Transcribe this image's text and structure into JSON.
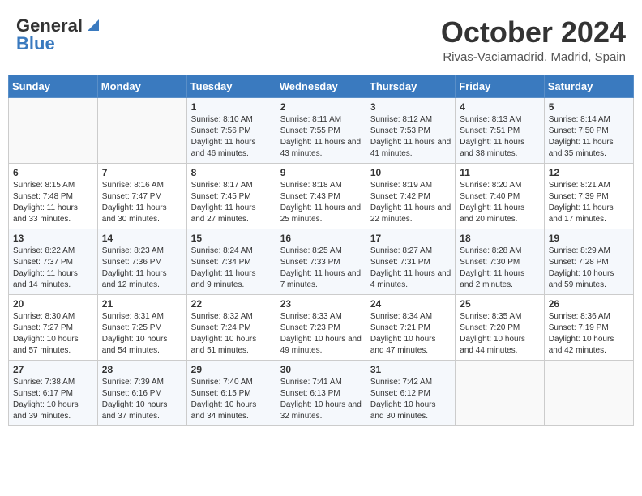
{
  "header": {
    "logo_general": "General",
    "logo_blue": "Blue",
    "month": "October 2024",
    "location": "Rivas-Vaciamadrid, Madrid, Spain"
  },
  "weekdays": [
    "Sunday",
    "Monday",
    "Tuesday",
    "Wednesday",
    "Thursday",
    "Friday",
    "Saturday"
  ],
  "weeks": [
    [
      {
        "day": "",
        "info": ""
      },
      {
        "day": "",
        "info": ""
      },
      {
        "day": "1",
        "info": "Sunrise: 8:10 AM\nSunset: 7:56 PM\nDaylight: 11 hours and 46 minutes."
      },
      {
        "day": "2",
        "info": "Sunrise: 8:11 AM\nSunset: 7:55 PM\nDaylight: 11 hours and 43 minutes."
      },
      {
        "day": "3",
        "info": "Sunrise: 8:12 AM\nSunset: 7:53 PM\nDaylight: 11 hours and 41 minutes."
      },
      {
        "day": "4",
        "info": "Sunrise: 8:13 AM\nSunset: 7:51 PM\nDaylight: 11 hours and 38 minutes."
      },
      {
        "day": "5",
        "info": "Sunrise: 8:14 AM\nSunset: 7:50 PM\nDaylight: 11 hours and 35 minutes."
      }
    ],
    [
      {
        "day": "6",
        "info": "Sunrise: 8:15 AM\nSunset: 7:48 PM\nDaylight: 11 hours and 33 minutes."
      },
      {
        "day": "7",
        "info": "Sunrise: 8:16 AM\nSunset: 7:47 PM\nDaylight: 11 hours and 30 minutes."
      },
      {
        "day": "8",
        "info": "Sunrise: 8:17 AM\nSunset: 7:45 PM\nDaylight: 11 hours and 27 minutes."
      },
      {
        "day": "9",
        "info": "Sunrise: 8:18 AM\nSunset: 7:43 PM\nDaylight: 11 hours and 25 minutes."
      },
      {
        "day": "10",
        "info": "Sunrise: 8:19 AM\nSunset: 7:42 PM\nDaylight: 11 hours and 22 minutes."
      },
      {
        "day": "11",
        "info": "Sunrise: 8:20 AM\nSunset: 7:40 PM\nDaylight: 11 hours and 20 minutes."
      },
      {
        "day": "12",
        "info": "Sunrise: 8:21 AM\nSunset: 7:39 PM\nDaylight: 11 hours and 17 minutes."
      }
    ],
    [
      {
        "day": "13",
        "info": "Sunrise: 8:22 AM\nSunset: 7:37 PM\nDaylight: 11 hours and 14 minutes."
      },
      {
        "day": "14",
        "info": "Sunrise: 8:23 AM\nSunset: 7:36 PM\nDaylight: 11 hours and 12 minutes."
      },
      {
        "day": "15",
        "info": "Sunrise: 8:24 AM\nSunset: 7:34 PM\nDaylight: 11 hours and 9 minutes."
      },
      {
        "day": "16",
        "info": "Sunrise: 8:25 AM\nSunset: 7:33 PM\nDaylight: 11 hours and 7 minutes."
      },
      {
        "day": "17",
        "info": "Sunrise: 8:27 AM\nSunset: 7:31 PM\nDaylight: 11 hours and 4 minutes."
      },
      {
        "day": "18",
        "info": "Sunrise: 8:28 AM\nSunset: 7:30 PM\nDaylight: 11 hours and 2 minutes."
      },
      {
        "day": "19",
        "info": "Sunrise: 8:29 AM\nSunset: 7:28 PM\nDaylight: 10 hours and 59 minutes."
      }
    ],
    [
      {
        "day": "20",
        "info": "Sunrise: 8:30 AM\nSunset: 7:27 PM\nDaylight: 10 hours and 57 minutes."
      },
      {
        "day": "21",
        "info": "Sunrise: 8:31 AM\nSunset: 7:25 PM\nDaylight: 10 hours and 54 minutes."
      },
      {
        "day": "22",
        "info": "Sunrise: 8:32 AM\nSunset: 7:24 PM\nDaylight: 10 hours and 51 minutes."
      },
      {
        "day": "23",
        "info": "Sunrise: 8:33 AM\nSunset: 7:23 PM\nDaylight: 10 hours and 49 minutes."
      },
      {
        "day": "24",
        "info": "Sunrise: 8:34 AM\nSunset: 7:21 PM\nDaylight: 10 hours and 47 minutes."
      },
      {
        "day": "25",
        "info": "Sunrise: 8:35 AM\nSunset: 7:20 PM\nDaylight: 10 hours and 44 minutes."
      },
      {
        "day": "26",
        "info": "Sunrise: 8:36 AM\nSunset: 7:19 PM\nDaylight: 10 hours and 42 minutes."
      }
    ],
    [
      {
        "day": "27",
        "info": "Sunrise: 7:38 AM\nSunset: 6:17 PM\nDaylight: 10 hours and 39 minutes."
      },
      {
        "day": "28",
        "info": "Sunrise: 7:39 AM\nSunset: 6:16 PM\nDaylight: 10 hours and 37 minutes."
      },
      {
        "day": "29",
        "info": "Sunrise: 7:40 AM\nSunset: 6:15 PM\nDaylight: 10 hours and 34 minutes."
      },
      {
        "day": "30",
        "info": "Sunrise: 7:41 AM\nSunset: 6:13 PM\nDaylight: 10 hours and 32 minutes."
      },
      {
        "day": "31",
        "info": "Sunrise: 7:42 AM\nSunset: 6:12 PM\nDaylight: 10 hours and 30 minutes."
      },
      {
        "day": "",
        "info": ""
      },
      {
        "day": "",
        "info": ""
      }
    ]
  ]
}
